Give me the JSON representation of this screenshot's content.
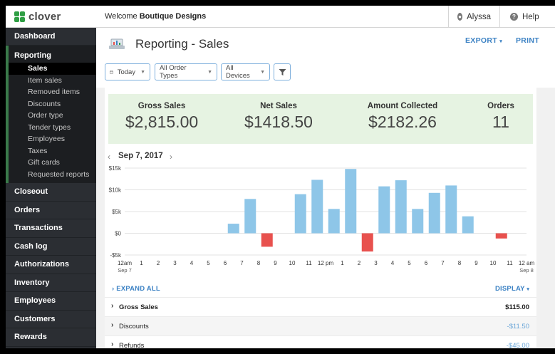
{
  "brand": {
    "name": "clover",
    "color": "#2f9e44"
  },
  "topbar": {
    "welcome_prefix": "Welcome",
    "merchant": "Boutique Designs",
    "user": "Alyssa",
    "help": "Help"
  },
  "sidebar": {
    "dashboard": "Dashboard",
    "reporting": {
      "title": "Reporting",
      "items": [
        "Sales",
        "Item sales",
        "Removed items",
        "Discounts",
        "Order type",
        "Tender types",
        "Employees",
        "Taxes",
        "Gift cards",
        "Requested reports"
      ],
      "active": "Sales"
    },
    "items": [
      "Closeout",
      "Orders",
      "Transactions",
      "Cash log",
      "Authorizations",
      "Inventory",
      "Employees",
      "Customers",
      "Rewards"
    ]
  },
  "header": {
    "title": "Reporting - Sales",
    "export": "EXPORT",
    "print": "PRINT",
    "filters": {
      "date": "Today",
      "order_types": "All Order Types",
      "devices": "All Devices"
    }
  },
  "summary": {
    "gross_sales": {
      "label": "Gross Sales",
      "value": "$2,815.00"
    },
    "net_sales": {
      "label": "Net Sales",
      "value": "$1418.50"
    },
    "amount_collected": {
      "label": "Amount Collected",
      "value": "$2182.26"
    },
    "orders": {
      "label": "Orders",
      "value": "11"
    }
  },
  "chart_nav": {
    "date": "Sep 7, 2017"
  },
  "chart_data": {
    "type": "bar",
    "categories": [
      "12am",
      "1",
      "2",
      "3",
      "4",
      "5",
      "6",
      "7",
      "8",
      "9",
      "10",
      "11",
      "12 pm",
      "1",
      "2",
      "3",
      "4",
      "5",
      "6",
      "7",
      "8",
      "9",
      "10",
      "11",
      "12 am"
    ],
    "first_sublabel": "Sep 7",
    "last_sublabel": "Sep 8",
    "bar_hours": [
      7,
      8,
      9,
      10,
      11,
      12,
      13,
      14,
      15,
      16,
      17,
      18,
      19,
      20,
      21,
      22,
      23
    ],
    "values": [
      2200,
      7900,
      -3100,
      9000,
      12300,
      5600,
      14800,
      -4200,
      10800,
      12200,
      5600,
      9300,
      11000,
      3900,
      -1200
    ],
    "value_hours": [
      6.5,
      7.5,
      8.5,
      10.5,
      11.5,
      12.5,
      13.5,
      14.5,
      15.5,
      16.5,
      17.5,
      18.5,
      19.5,
      20.5,
      22.5
    ],
    "yticks": [
      "$15k",
      "$10k",
      "$5k",
      "$0",
      "-$5k"
    ],
    "ylim": [
      -5000,
      15000
    ],
    "positive_color": "#8ec6e8",
    "negative_color": "#e8514e"
  },
  "details": {
    "expand_all": "EXPAND ALL",
    "display": "DISPLAY",
    "rows": [
      {
        "name": "Gross Sales",
        "amount": "$115.00"
      },
      {
        "name": "Discounts",
        "amount": "-$11.50"
      },
      {
        "name": "Refunds",
        "amount": "-$45.00"
      }
    ]
  }
}
